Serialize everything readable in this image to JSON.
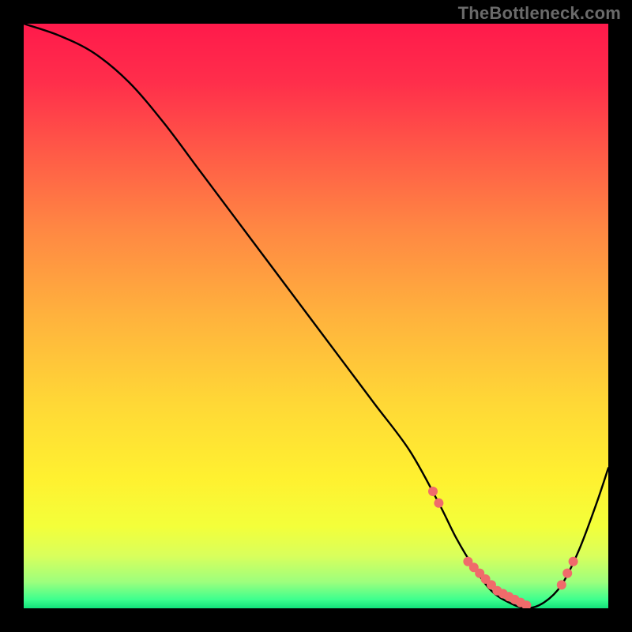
{
  "attribution": "TheBottleneck.com",
  "chart_data": {
    "type": "line",
    "title": "",
    "xlabel": "",
    "ylabel": "",
    "xlim": [
      0,
      100
    ],
    "ylim": [
      0,
      100
    ],
    "grid": false,
    "legend": false,
    "x": [
      0,
      6,
      12,
      18,
      24,
      30,
      36,
      42,
      48,
      54,
      60,
      66,
      71,
      74,
      77,
      80,
      83,
      86,
      89,
      92,
      95,
      98,
      100
    ],
    "values": [
      100,
      98,
      95,
      90,
      83,
      75,
      67,
      59,
      51,
      43,
      35,
      27,
      18,
      12,
      7,
      3,
      1,
      0,
      1,
      4,
      10,
      18,
      24
    ],
    "marker_points": [
      {
        "x": 70,
        "y": 20
      },
      {
        "x": 71,
        "y": 18
      },
      {
        "x": 76,
        "y": 8
      },
      {
        "x": 77,
        "y": 7
      },
      {
        "x": 78,
        "y": 6
      },
      {
        "x": 79,
        "y": 5
      },
      {
        "x": 80,
        "y": 4
      },
      {
        "x": 81,
        "y": 3
      },
      {
        "x": 82,
        "y": 2.5
      },
      {
        "x": 83,
        "y": 2
      },
      {
        "x": 84,
        "y": 1.5
      },
      {
        "x": 85,
        "y": 1
      },
      {
        "x": 86,
        "y": 0.5
      },
      {
        "x": 92,
        "y": 4
      },
      {
        "x": 93,
        "y": 6
      },
      {
        "x": 94,
        "y": 8
      }
    ],
    "gradient_stops": [
      {
        "offset": 0.0,
        "color": "#ff1a4b"
      },
      {
        "offset": 0.1,
        "color": "#ff2e4b"
      },
      {
        "offset": 0.22,
        "color": "#ff5a47"
      },
      {
        "offset": 0.35,
        "color": "#ff8743"
      },
      {
        "offset": 0.5,
        "color": "#ffb23d"
      },
      {
        "offset": 0.65,
        "color": "#ffd836"
      },
      {
        "offset": 0.78,
        "color": "#fff130"
      },
      {
        "offset": 0.86,
        "color": "#f3ff3a"
      },
      {
        "offset": 0.91,
        "color": "#d9ff5c"
      },
      {
        "offset": 0.955,
        "color": "#9dff7d"
      },
      {
        "offset": 0.985,
        "color": "#3dff8e"
      },
      {
        "offset": 1.0,
        "color": "#12e27b"
      }
    ],
    "curve_color": "#000000",
    "marker_color": "#f06b6b",
    "marker_radius_px": 6
  }
}
